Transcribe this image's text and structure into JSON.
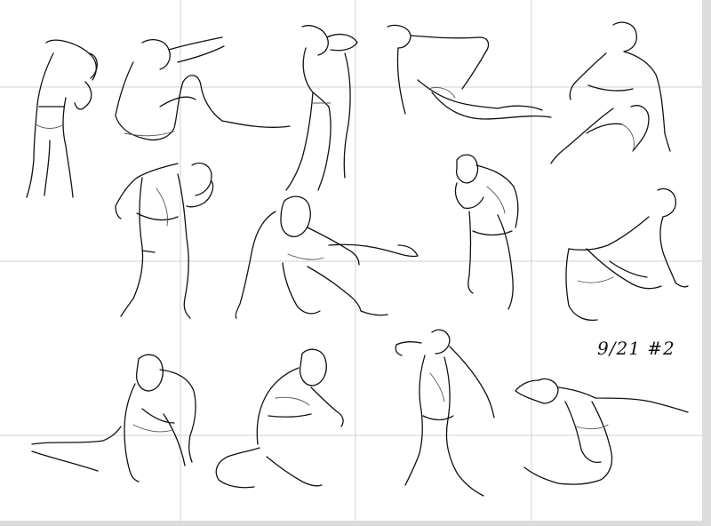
{
  "canvas": {
    "background": "#ffffff",
    "grid_color": "#d0d0d0",
    "stroke_color": "#111111"
  },
  "annotation": {
    "text": "9/21  #2"
  },
  "sketches": [
    {
      "name": "figure-standing-back-1"
    },
    {
      "name": "figure-reclining-1"
    },
    {
      "name": "figure-standing-twist"
    },
    {
      "name": "figure-reclining-2"
    },
    {
      "name": "figure-kneeling-1"
    },
    {
      "name": "figure-bending-back"
    },
    {
      "name": "figure-crawling"
    },
    {
      "name": "figure-standing-hand-face"
    },
    {
      "name": "figure-seated-lean-back"
    },
    {
      "name": "figure-crouching-front"
    },
    {
      "name": "figure-kneeling-reach"
    },
    {
      "name": "figure-standing-arm-raised"
    },
    {
      "name": "figure-seated-arms-out"
    }
  ]
}
